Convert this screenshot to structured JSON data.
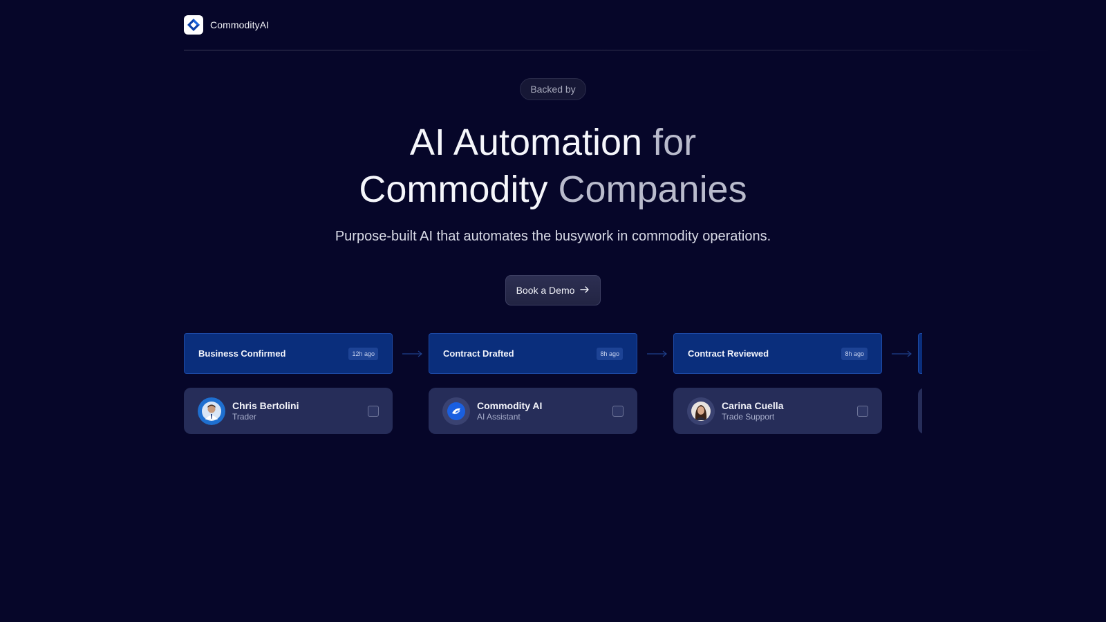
{
  "brand": {
    "name": "CommodityAI",
    "logo_icon": "diamond-logo-icon",
    "accent": "#0b3fa8"
  },
  "hero": {
    "badge": "Backed by",
    "title_line1_a": "AI Automation",
    "title_line1_b": " for",
    "title_line2_a": "Commodity",
    "title_line2_b": " Companies",
    "subtitle": "Purpose-built AI that automates the busywork in commodity operations.",
    "cta_label": "Book a Demo",
    "cta_icon": "arrow-right-icon"
  },
  "workflow": {
    "stages": [
      {
        "title": "Business Confirmed",
        "time": "12h ago"
      },
      {
        "title": "Contract Drafted",
        "time": "8h ago"
      },
      {
        "title": "Contract Reviewed",
        "time": "8h ago"
      }
    ],
    "people": [
      {
        "name": "Chris Bertolini",
        "role": "Trader",
        "avatar": "person-avatar-icon",
        "checked": false
      },
      {
        "name": "Commodity AI",
        "role": "AI Assistant",
        "avatar": "ai-logo-icon",
        "checked": false
      },
      {
        "name": "Carina Cuella",
        "role": "Trade Support",
        "avatar": "person-avatar-icon",
        "checked": false
      }
    ],
    "colors": {
      "stage_bg": "#0a2e7c",
      "card_bg": "#262d59",
      "page_bg": "#060629"
    }
  }
}
